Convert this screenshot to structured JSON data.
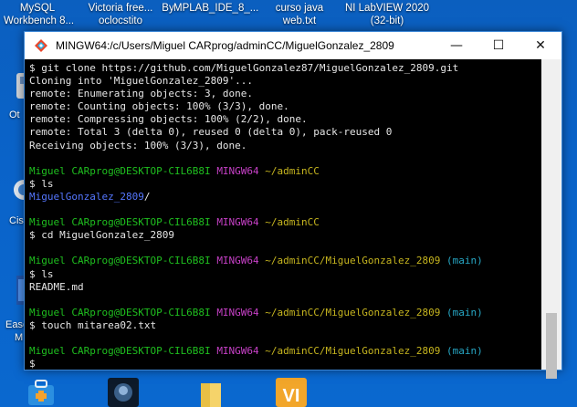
{
  "desktop": {
    "top_labels": [
      {
        "line1": "MySQL",
        "line2": "Workbench 8..."
      },
      {
        "line1": "Victoria free...",
        "line2": "By"
      },
      {
        "line1": "MPLAB_IDE_8_...",
        "line2": ""
      },
      {
        "line1": "curso java",
        "line2": "web.txt"
      },
      {
        "line1": "NI LabVIEW 2020",
        "line2": "(32-bit)"
      },
      {
        "line1": "",
        "line2": "oclocstito"
      }
    ],
    "left_labels": [
      "Ot",
      "Cis",
      "Ease",
      "M"
    ]
  },
  "window": {
    "title": "MINGW64:/c/Users/Miguel CARprog/adminCC/MiguelGonzalez_2809",
    "buttons": {
      "minimize": "—",
      "maximize": "☐",
      "close": "✕"
    }
  },
  "terminal": {
    "lines": [
      {
        "parts": [
          {
            "t": "$ git clone https://github.com/MiguelGonzalez87/MiguelGonzalez_2809.git",
            "c": "white"
          }
        ]
      },
      {
        "parts": [
          {
            "t": "Cloning into 'MiguelGonzalez_2809'...",
            "c": "white"
          }
        ]
      },
      {
        "parts": [
          {
            "t": "remote: Enumerating objects: 3, done.",
            "c": "white"
          }
        ]
      },
      {
        "parts": [
          {
            "t": "remote: Counting objects: 100% (3/3), done.",
            "c": "white"
          }
        ]
      },
      {
        "parts": [
          {
            "t": "remote: Compressing objects: 100% (2/2), done.",
            "c": "white"
          }
        ]
      },
      {
        "parts": [
          {
            "t": "remote: Total 3 (delta 0), reused 0 (delta 0), pack-reused 0",
            "c": "white"
          }
        ]
      },
      {
        "parts": [
          {
            "t": "Receiving objects: 100% (3/3), done.",
            "c": "white"
          }
        ]
      },
      {
        "parts": [
          {
            "t": "",
            "c": "white"
          }
        ]
      },
      {
        "parts": [
          {
            "t": "Miguel CARprog@DESKTOP-CIL6B8I ",
            "c": "green"
          },
          {
            "t": "MINGW64 ",
            "c": "mag"
          },
          {
            "t": "~/adminCC",
            "c": "yel"
          }
        ]
      },
      {
        "parts": [
          {
            "t": "$ ls",
            "c": "white"
          }
        ]
      },
      {
        "parts": [
          {
            "t": "MiguelGonzalez_2809",
            "c": "blue"
          },
          {
            "t": "/",
            "c": "white"
          }
        ]
      },
      {
        "parts": [
          {
            "t": "",
            "c": "white"
          }
        ]
      },
      {
        "parts": [
          {
            "t": "Miguel CARprog@DESKTOP-CIL6B8I ",
            "c": "green"
          },
          {
            "t": "MINGW64 ",
            "c": "mag"
          },
          {
            "t": "~/adminCC",
            "c": "yel"
          }
        ]
      },
      {
        "parts": [
          {
            "t": "$ cd MiguelGonzalez_2809",
            "c": "white"
          }
        ]
      },
      {
        "parts": [
          {
            "t": "",
            "c": "white"
          }
        ]
      },
      {
        "parts": [
          {
            "t": "Miguel CARprog@DESKTOP-CIL6B8I ",
            "c": "green"
          },
          {
            "t": "MINGW64 ",
            "c": "mag"
          },
          {
            "t": "~/adminCC/MiguelGonzalez_2809 ",
            "c": "yel"
          },
          {
            "t": "(main)",
            "c": "cyan"
          }
        ]
      },
      {
        "parts": [
          {
            "t": "$ ls",
            "c": "white"
          }
        ]
      },
      {
        "parts": [
          {
            "t": "README.md",
            "c": "white"
          }
        ]
      },
      {
        "parts": [
          {
            "t": "",
            "c": "white"
          }
        ]
      },
      {
        "parts": [
          {
            "t": "Miguel CARprog@DESKTOP-CIL6B8I ",
            "c": "green"
          },
          {
            "t": "MINGW64 ",
            "c": "mag"
          },
          {
            "t": "~/adminCC/MiguelGonzalez_2809 ",
            "c": "yel"
          },
          {
            "t": "(main)",
            "c": "cyan"
          }
        ]
      },
      {
        "parts": [
          {
            "t": "$ touch mitarea02.txt",
            "c": "white"
          }
        ]
      },
      {
        "parts": [
          {
            "t": "",
            "c": "white"
          }
        ]
      },
      {
        "parts": [
          {
            "t": "Miguel CARprog@DESKTOP-CIL6B8I ",
            "c": "green"
          },
          {
            "t": "MINGW64 ",
            "c": "mag"
          },
          {
            "t": "~/adminCC/MiguelGonzalez_2809 ",
            "c": "yel"
          },
          {
            "t": "(main)",
            "c": "cyan"
          }
        ]
      },
      {
        "parts": [
          {
            "t": "$",
            "c": "white"
          }
        ]
      }
    ]
  },
  "colors": {
    "desktop_bg": "#0a63c9",
    "prompt_user": "#1fbf1f",
    "prompt_mingw": "#c640c6",
    "prompt_path": "#c6b51f",
    "prompt_branch": "#27a8c6",
    "dir_listing": "#5577ff"
  },
  "icons": {
    "title": "git-bash-diamond-icon",
    "taskbar": [
      "toolbox-icon",
      "game-icon",
      "folder-icon",
      "labview-icon"
    ]
  }
}
